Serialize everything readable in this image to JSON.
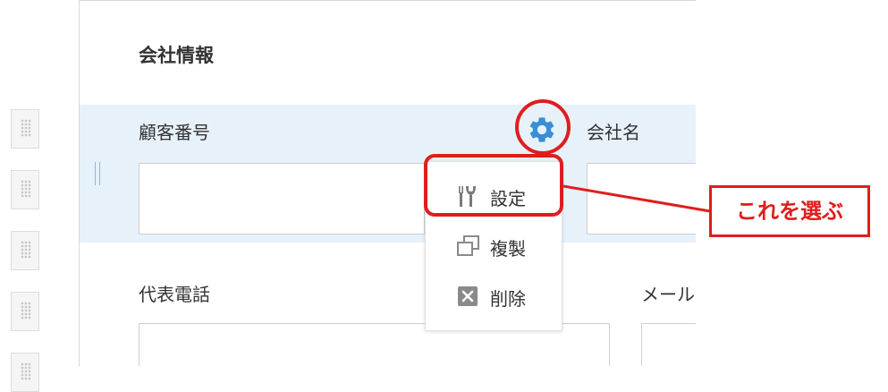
{
  "form": {
    "section_title": "会社情報",
    "fields": {
      "customer_number": {
        "label": "顧客番号",
        "value": ""
      },
      "company_name": {
        "label": "会社名",
        "value": ""
      },
      "main_phone": {
        "label": "代表電話",
        "value": ""
      },
      "email": {
        "label": "メール",
        "value": ""
      }
    }
  },
  "field_menu": {
    "items": [
      {
        "label": "設定",
        "icon": "wrench-screwdriver-icon"
      },
      {
        "label": "複製",
        "icon": "duplicate-icon"
      },
      {
        "label": "削除",
        "icon": "delete-x-icon"
      }
    ]
  },
  "annotation": {
    "callout_text": "これを選ぶ",
    "color": "#e01d1d"
  },
  "colors": {
    "gear": "#3a8ed6",
    "row_highlight": "#e7f1fa",
    "delete_icon": "#8a8a8a",
    "settings_icon": "#7a7a7a"
  },
  "palette": {
    "icon": "drag-handle-icon"
  }
}
